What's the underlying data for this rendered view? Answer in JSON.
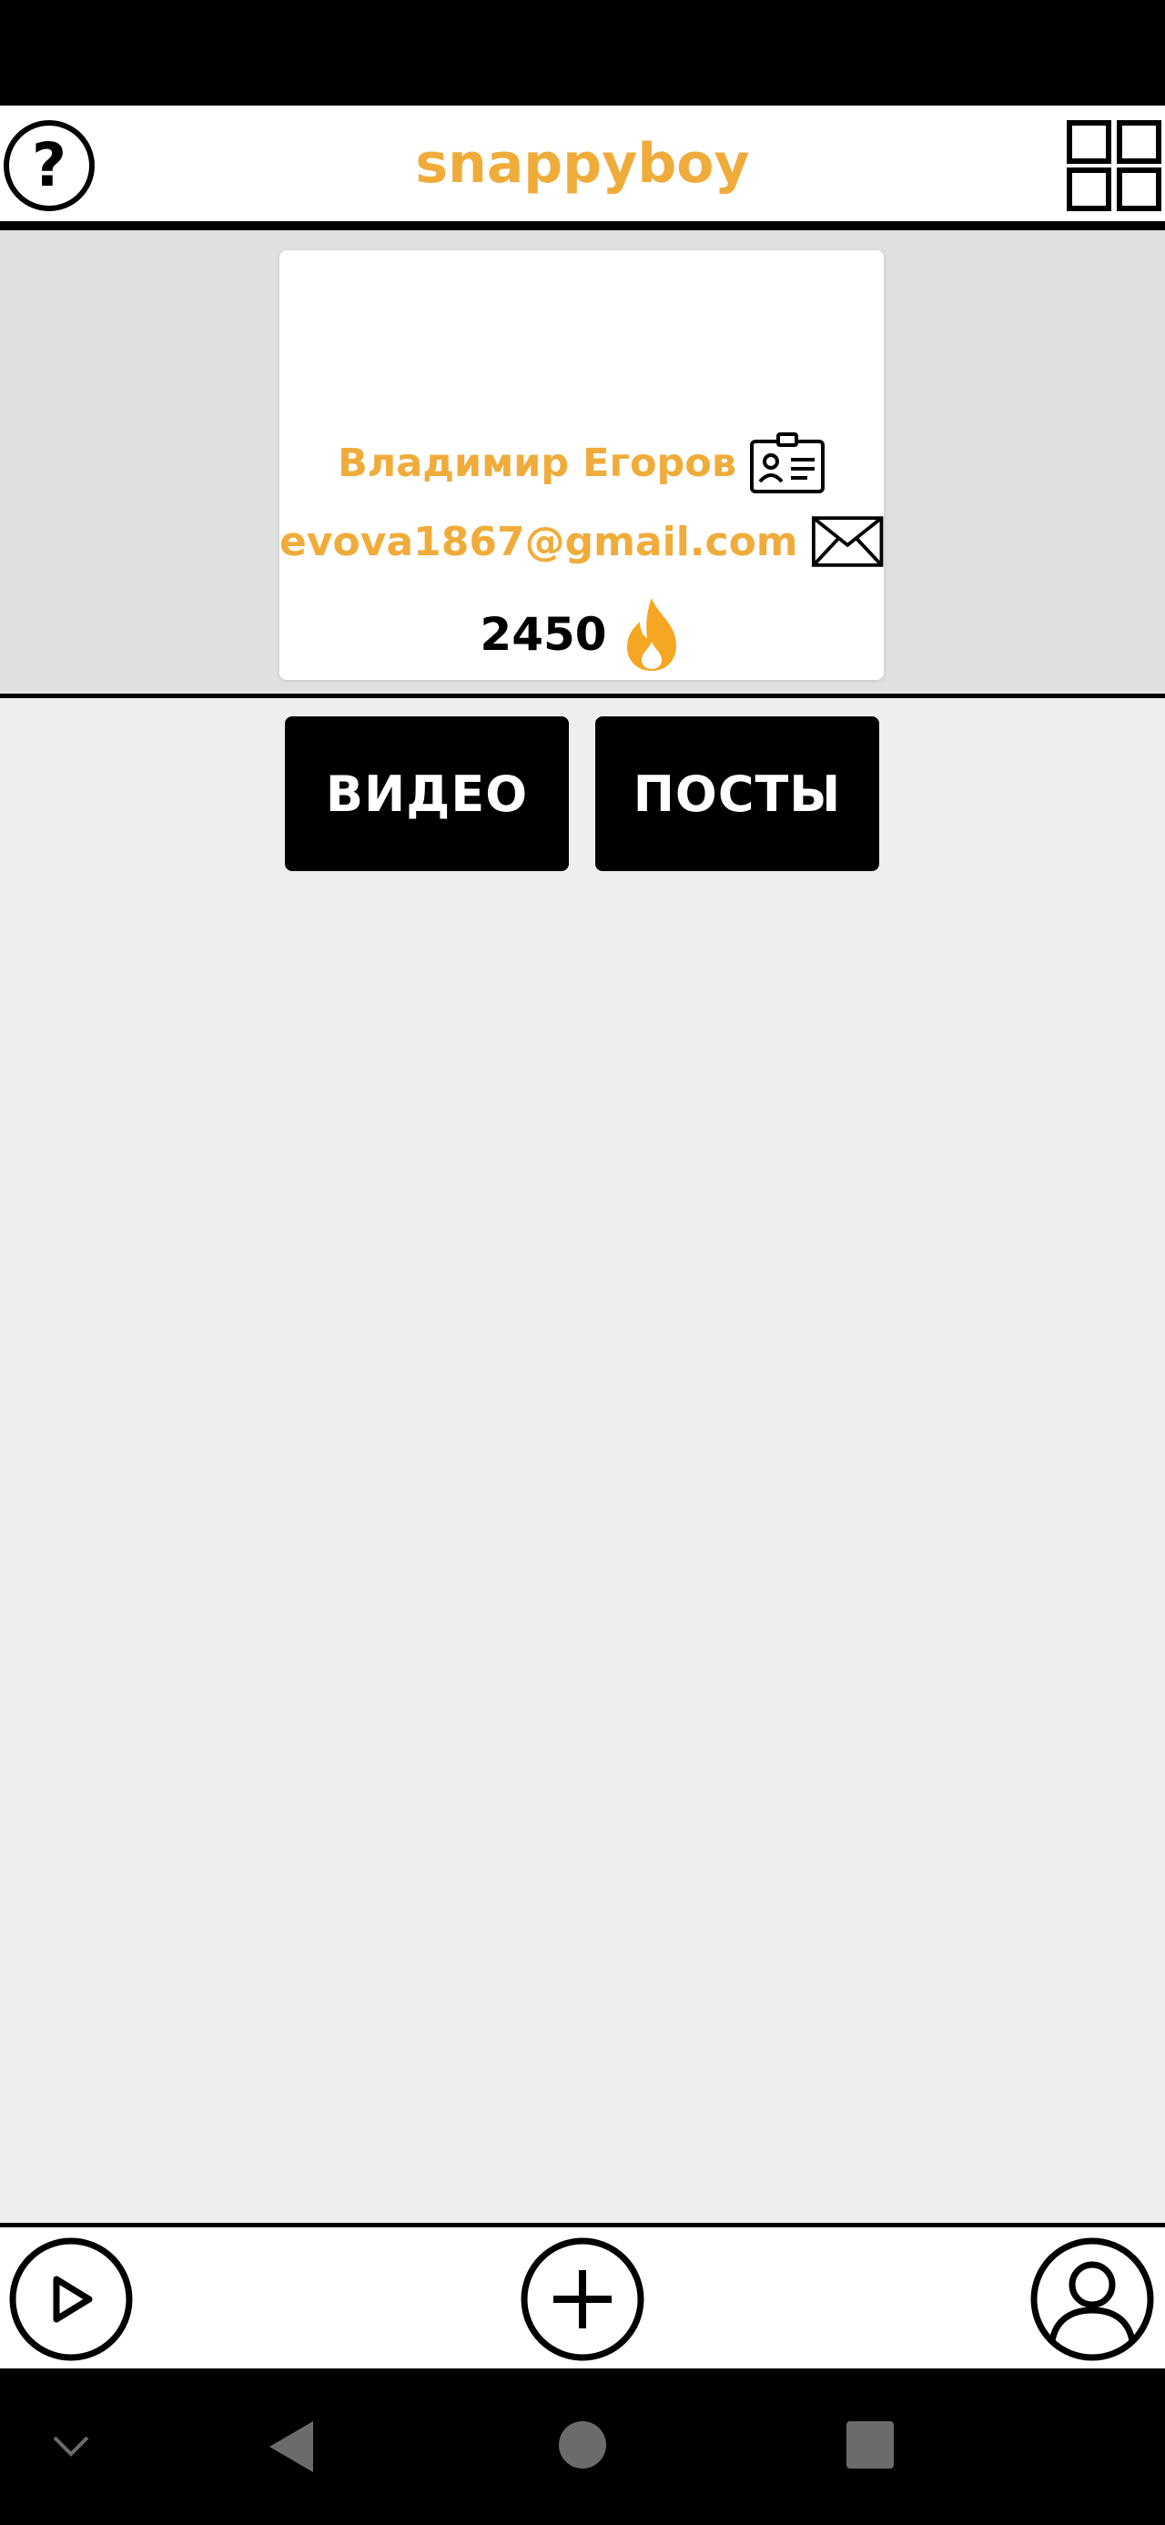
{
  "header": {
    "help_glyph": "?",
    "title": "snappyboy"
  },
  "profile": {
    "name": "Владимир Егоров",
    "email": "evova1867@gmail.com",
    "score": "2450"
  },
  "tabs": [
    {
      "label": "ВИДЕО"
    },
    {
      "label": "ПОСТЫ"
    }
  ],
  "icons": {
    "help": "help-icon",
    "menu": "grid-icon",
    "name": "id-card-icon",
    "email": "envelope-icon",
    "score": "fire-icon",
    "play": "play-icon",
    "add": "plus-icon",
    "profile": "user-icon"
  },
  "colors": {
    "accent": "#f0ac3b",
    "fire": "#f5a623",
    "header_bg": "#ffffff",
    "profile_bg": "#e0e0e0",
    "content_bg": "#eeeeee",
    "button_bg": "#000000"
  }
}
